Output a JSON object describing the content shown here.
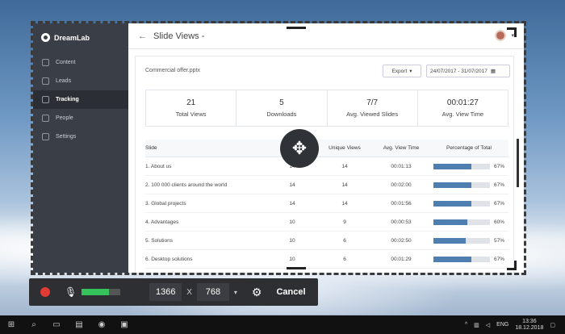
{
  "sidebar": {
    "brand": "DreamLab",
    "items": [
      {
        "label": "Content"
      },
      {
        "label": "Leads"
      },
      {
        "label": "Tracking"
      },
      {
        "label": "People"
      },
      {
        "label": "Settings"
      }
    ]
  },
  "header": {
    "title": "Slide Views -",
    "back": "←"
  },
  "report": {
    "file": "Commercial offer.pptx",
    "export": "Export",
    "date_range": "24/07/2017 - 31/07/2017",
    "stats": [
      {
        "value": "21",
        "label": "Total Views"
      },
      {
        "value": "5",
        "label": "Downloads"
      },
      {
        "value": "7/7",
        "label": "Avg. Viewed Slides"
      },
      {
        "value": "00:01:27",
        "label": "Avg. View Time"
      }
    ],
    "columns": [
      "Slide",
      "Views",
      "Unique Views",
      "Avg. View Time",
      "Percentage of Total"
    ],
    "rows": [
      {
        "slide": "1. About us",
        "views": "14",
        "unique": "14",
        "time": "00:01:13",
        "pct": "67%",
        "pct_value": 0.67
      },
      {
        "slide": "2. 100 000 clients around the world",
        "views": "14",
        "unique": "14",
        "time": "00:02:00",
        "pct": "67%",
        "pct_value": 0.67
      },
      {
        "slide": "3. Global projects",
        "views": "14",
        "unique": "14",
        "time": "00:01:56",
        "pct": "67%",
        "pct_value": 0.67
      },
      {
        "slide": "4. Advantages",
        "views": "10",
        "unique": "9",
        "time": "00:00:53",
        "pct": "60%",
        "pct_value": 0.6
      },
      {
        "slide": "5. Solutions",
        "views": "10",
        "unique": "6",
        "time": "00:02:50",
        "pct": "57%",
        "pct_value": 0.57
      },
      {
        "slide": "6. Desktop solutions",
        "views": "10",
        "unique": "6",
        "time": "00:01:29",
        "pct": "67%",
        "pct_value": 0.67
      }
    ]
  },
  "recorder": {
    "width": "1366",
    "times": "X",
    "height": "768",
    "cancel": "Cancel",
    "mic_level": 0.7
  },
  "taskbar": {
    "lang": "ENG",
    "time": "13:36",
    "date": "18.12.2018"
  },
  "colors": {
    "sidebar": "#3a3f47",
    "bar_fill": "#4e7fb0",
    "record": "#e23b36",
    "meter": "#36c25a"
  }
}
